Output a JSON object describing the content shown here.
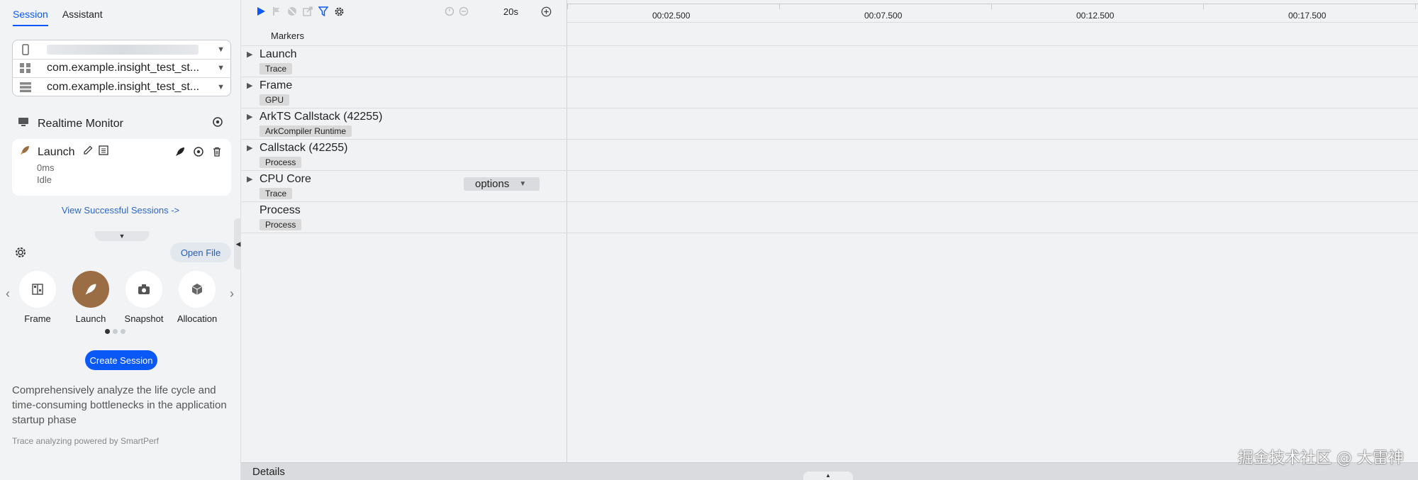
{
  "sidebar": {
    "tabs": [
      {
        "label": "Session",
        "active": true
      },
      {
        "label": "Assistant",
        "active": false
      }
    ],
    "device_selectors": [
      {
        "icon": "phone-icon",
        "value": ""
      },
      {
        "icon": "apps-icon",
        "value": "com.example.insight_test_st..."
      },
      {
        "icon": "process-list-icon",
        "value": "com.example.insight_test_st..."
      }
    ],
    "realtime_monitor": {
      "label": "Realtime Monitor",
      "card": {
        "name": "Launch",
        "duration": "0ms",
        "status": "Idle"
      }
    },
    "view_sessions_link": "View Successful Sessions ->",
    "open_file_label": "Open File",
    "tools": [
      {
        "label": "Frame",
        "icon": "frame-icon",
        "active": false
      },
      {
        "label": "Launch",
        "icon": "rocket-icon",
        "active": true
      },
      {
        "label": "Snapshot",
        "icon": "camera-icon",
        "active": false
      },
      {
        "label": "Allocation",
        "icon": "cube-icon",
        "active": false
      }
    ],
    "create_session_label": "Create Session",
    "description": "Comprehensively analyze the life cycle and time-consuming bottlenecks in the application startup phase",
    "powered_by": "Trace analyzing powered by SmartPerf"
  },
  "toolbar": {
    "zoom": "20s"
  },
  "timeline": {
    "ticks": [
      "00:02.500",
      "00:07.500",
      "00:12.500",
      "00:17.500"
    ],
    "markers_label": "Markers",
    "tracks": [
      {
        "name": "Launch",
        "tag": "Trace",
        "expandable": true
      },
      {
        "name": "Frame",
        "tag": "GPU",
        "expandable": true
      },
      {
        "name": "ArkTS Callstack (42255)",
        "tag": "ArkCompiler Runtime",
        "expandable": true
      },
      {
        "name": "Callstack (42255)",
        "tag": "Process",
        "expandable": true
      },
      {
        "name": "CPU Core",
        "tag": "Trace",
        "expandable": true,
        "options": "options"
      },
      {
        "name": "Process",
        "tag": "Process",
        "expandable": false
      }
    ]
  },
  "details_label": "Details",
  "watermark": "掘金技术社区 @ 大雷神",
  "colors": {
    "accent": "#0a59f7",
    "launch_active": "#9b6d45",
    "link": "#2f66c8"
  }
}
